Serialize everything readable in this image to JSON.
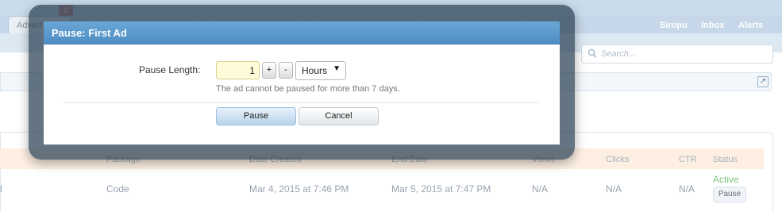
{
  "background": {
    "tab_label": "Advert",
    "tab_badge": "2",
    "user_menu": [
      "Siropu",
      "Inbox",
      "Alerts"
    ],
    "search_placeholder": "Search...",
    "table": {
      "headers": [
        "Package",
        "Date Created",
        "End Date",
        "Views",
        "Clicks",
        "CTR",
        "Status"
      ],
      "row": {
        "edge": "l",
        "package": "Code",
        "date_created": "Mar 4, 2015 at 7:46 PM",
        "end_date": "Mar 5, 2015 at 7:47 PM",
        "views": "N/A",
        "clicks": "N/A",
        "ctr": "N/A",
        "status": "Active",
        "action": "Pause"
      }
    }
  },
  "modal": {
    "title": "Pause: First Ad",
    "pause_length_label": "Pause Length:",
    "pause_length_value": "1",
    "increment_label": "+",
    "decrement_label": "-",
    "unit_selected": "Hours",
    "hint": "The ad cannot be paused for more than 7 days.",
    "pause_button": "Pause",
    "cancel_button": "Cancel"
  },
  "colors": {
    "modal_header": "#5a9acd",
    "status_active": "#6cbf6c",
    "table_header_bg": "#fdeee0"
  }
}
